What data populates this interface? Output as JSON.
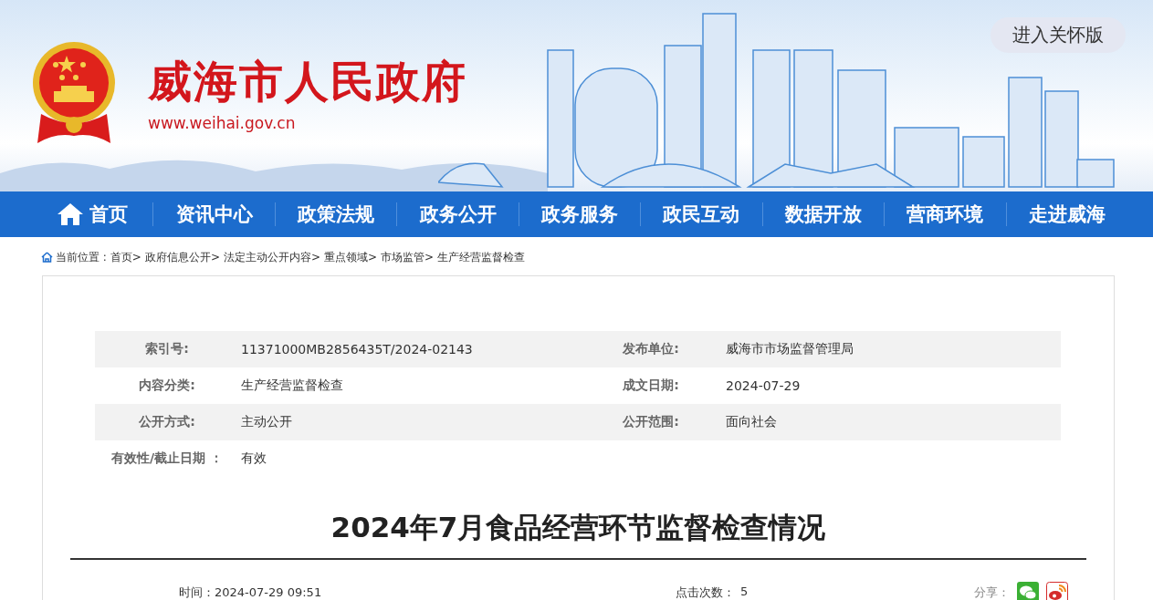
{
  "header": {
    "site_title": "威海市人民政府",
    "site_url": "www.weihai.gov.cn",
    "care_button": "进入关怀版"
  },
  "nav": [
    "首页",
    "资讯中心",
    "政策法规",
    "政务公开",
    "政务服务",
    "政民互动",
    "数据开放",
    "营商环境",
    "走进威海"
  ],
  "breadcrumb": {
    "label": "当前位置 :",
    "items": [
      "首页>",
      "政府信息公开>",
      "法定主动公开内容>",
      "重点领域>",
      "市场监管>",
      "生产经营监督检查"
    ]
  },
  "meta": [
    {
      "cells": [
        {
          "label": "索引号:",
          "value": "11371000MB2856435T/2024-02143"
        },
        {
          "label": "发布单位:",
          "value": "威海市市场监督管理局"
        }
      ]
    },
    {
      "cells": [
        {
          "label": "内容分类:",
          "value": "生产经营监督检查"
        },
        {
          "label": "成文日期:",
          "value": "2024-07-29"
        }
      ]
    },
    {
      "cells": [
        {
          "label": "公开方式:",
          "value": "主动公开"
        },
        {
          "label": "公开范围:",
          "value": "面向社会"
        }
      ]
    },
    {
      "cells": [
        {
          "label": "有效性/截止日期 ：",
          "value": "有效"
        }
      ]
    }
  ],
  "article": {
    "title": "2024年7月食品经营环节监督检查情况",
    "time": "时间：2024-07-29 09:51",
    "clicks_label": "点击次数：",
    "clicks": "5",
    "share_label": "分享："
  }
}
